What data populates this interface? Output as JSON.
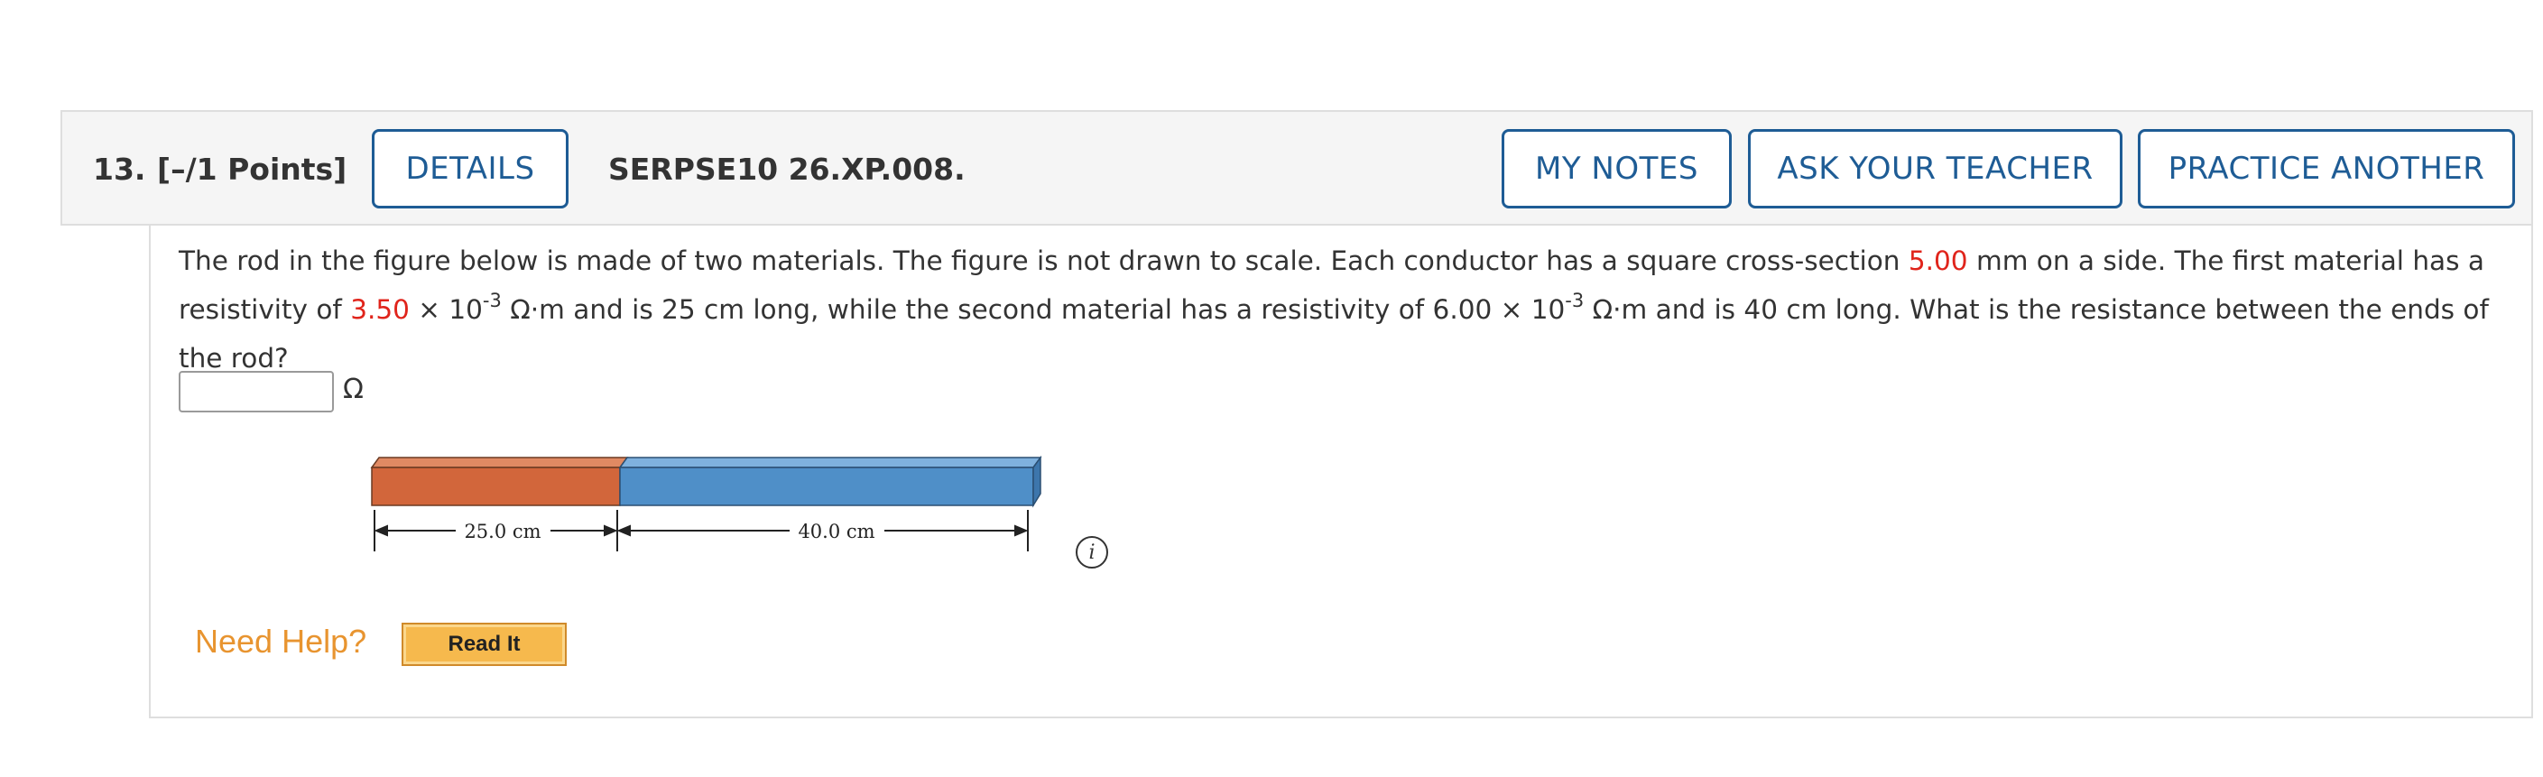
{
  "question": {
    "number": "13.",
    "points": "[–/1 Points]",
    "details_label": "DETAILS",
    "id": "SERPSE10 26.XP.008.",
    "my_notes_label": "MY NOTES",
    "ask_teacher_label": "ASK YOUR TEACHER",
    "practice_label": "PRACTICE ANOTHER"
  },
  "text": {
    "p1": "The rod in the figure below is made of two materials. The figure is not drawn to scale. Each conductor has a square cross-section ",
    "side": "5.00",
    "p2": " mm on a side. The first material has a resistivity of ",
    "rho1": "3.50",
    "times1": " × 10",
    "exp1": "-3",
    "p3": " Ω·m and is 25 cm long, while the second material has a resistivity of 6.00 × 10",
    "exp2": "-3",
    "p4": " Ω·m and is 40 cm long. What is the resistance between the ends of the rod?"
  },
  "answer": {
    "value": "",
    "unit": "Ω"
  },
  "figure": {
    "label_first": "25.0 cm",
    "label_second": "40.0 cm",
    "color_first": "#d2663b",
    "color_second": "#4f8fc8",
    "info_glyph": "i"
  },
  "help": {
    "need_help": "Need Help?",
    "read_it": "Read It"
  }
}
